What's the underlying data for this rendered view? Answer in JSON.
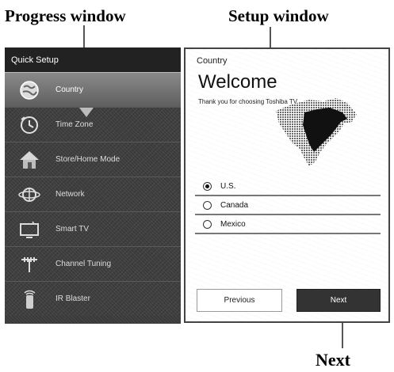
{
  "callouts": {
    "progress_window": "Progress window",
    "setup_window": "Setup window",
    "next": "Next"
  },
  "progress": {
    "header": "Quick Setup",
    "steps": [
      {
        "label": "Country",
        "icon": "globe-icon",
        "active": true
      },
      {
        "label": "Time Zone",
        "icon": "clock-icon",
        "active": false
      },
      {
        "label": "Store/Home Mode",
        "icon": "home-icon",
        "active": false
      },
      {
        "label": "Network",
        "icon": "network-icon",
        "active": false
      },
      {
        "label": "Smart TV",
        "icon": "tv-icon",
        "active": false
      },
      {
        "label": "Channel Tuning",
        "icon": "antenna-icon",
        "active": false
      },
      {
        "label": "IR Blaster",
        "icon": "ir-blaster-icon",
        "active": false
      }
    ]
  },
  "setup": {
    "title": "Country",
    "heading": "Welcome",
    "message": "Thank you for choosing Toshiba TV",
    "options": [
      {
        "label": "U.S.",
        "selected": true
      },
      {
        "label": "Canada",
        "selected": false
      },
      {
        "label": "Mexico",
        "selected": false
      }
    ],
    "previous_label": "Previous",
    "next_label": "Next"
  }
}
